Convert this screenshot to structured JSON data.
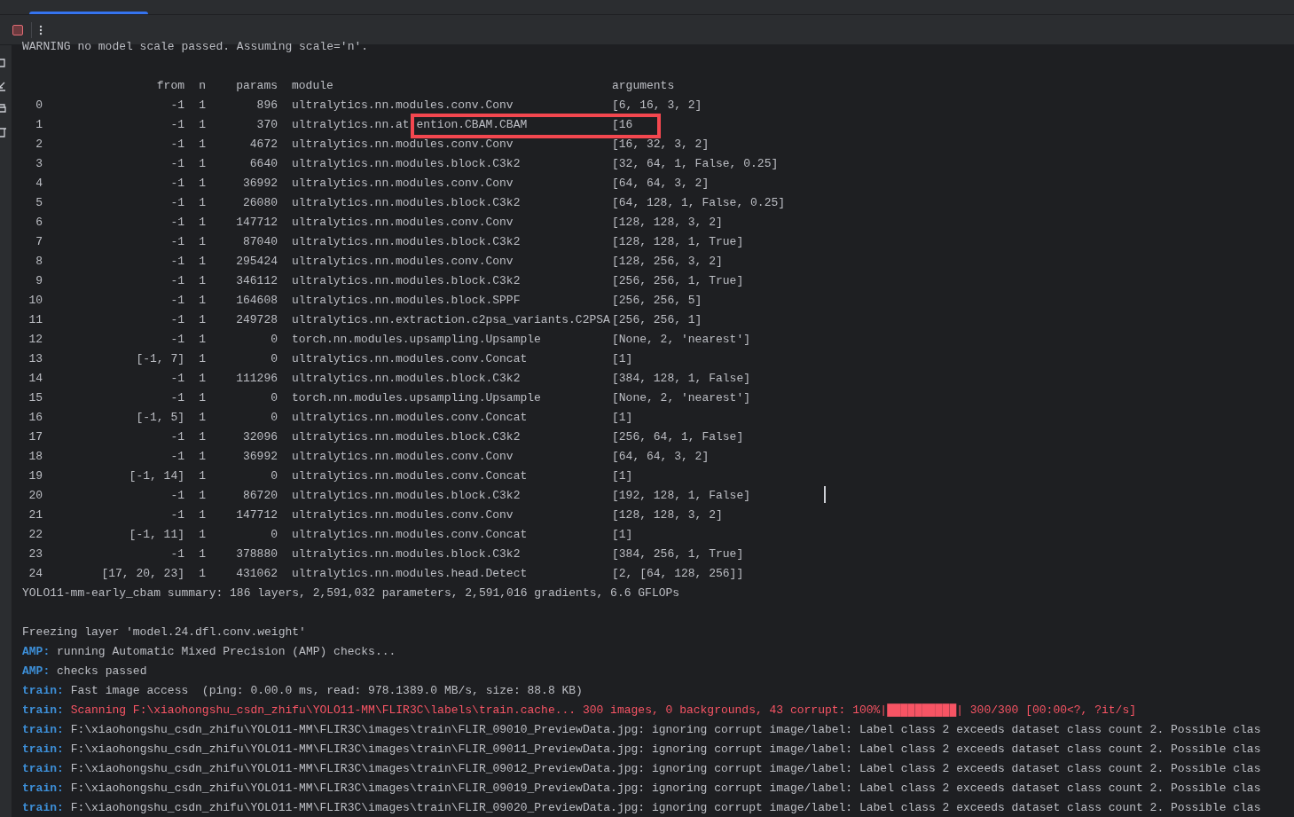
{
  "console": {
    "warning": "WARNING no model scale passed. Assuming scale='n'.",
    "header": {
      "from": "from",
      "n": "n",
      "params": "params",
      "module": "module",
      "arguments": "arguments"
    },
    "layers": [
      {
        "index": "0",
        "from": "-1",
        "n": "1",
        "params": "896",
        "module": "ultralytics.nn.modules.conv.Conv",
        "arguments": "[6, 16, 3, 2]"
      },
      {
        "index": "1",
        "from": "-1",
        "n": "1",
        "params": "370",
        "module": "ultralytics.nn.at",
        "module_continued": "ention.CBAM.CBAM",
        "arguments": "[16"
      },
      {
        "index": "2",
        "from": "-1",
        "n": "1",
        "params": "4672",
        "module": "ultralytics.nn.modules.conv.Conv",
        "arguments": "[16, 32, 3, 2]"
      },
      {
        "index": "3",
        "from": "-1",
        "n": "1",
        "params": "6640",
        "module": "ultralytics.nn.modules.block.C3k2",
        "arguments": "[32, 64, 1, False, 0.25]"
      },
      {
        "index": "4",
        "from": "-1",
        "n": "1",
        "params": "36992",
        "module": "ultralytics.nn.modules.conv.Conv",
        "arguments": "[64, 64, 3, 2]"
      },
      {
        "index": "5",
        "from": "-1",
        "n": "1",
        "params": "26080",
        "module": "ultralytics.nn.modules.block.C3k2",
        "arguments": "[64, 128, 1, False, 0.25]"
      },
      {
        "index": "6",
        "from": "-1",
        "n": "1",
        "params": "147712",
        "module": "ultralytics.nn.modules.conv.Conv",
        "arguments": "[128, 128, 3, 2]"
      },
      {
        "index": "7",
        "from": "-1",
        "n": "1",
        "params": "87040",
        "module": "ultralytics.nn.modules.block.C3k2",
        "arguments": "[128, 128, 1, True]"
      },
      {
        "index": "8",
        "from": "-1",
        "n": "1",
        "params": "295424",
        "module": "ultralytics.nn.modules.conv.Conv",
        "arguments": "[128, 256, 3, 2]"
      },
      {
        "index": "9",
        "from": "-1",
        "n": "1",
        "params": "346112",
        "module": "ultralytics.nn.modules.block.C3k2",
        "arguments": "[256, 256, 1, True]"
      },
      {
        "index": "10",
        "from": "-1",
        "n": "1",
        "params": "164608",
        "module": "ultralytics.nn.modules.block.SPPF",
        "arguments": "[256, 256, 5]"
      },
      {
        "index": "11",
        "from": "-1",
        "n": "1",
        "params": "249728",
        "module": "ultralytics.nn.extraction.c2psa_variants.C2PSA",
        "arguments": "[256, 256, 1]"
      },
      {
        "index": "12",
        "from": "-1",
        "n": "1",
        "params": "0",
        "module": "torch.nn.modules.upsampling.Upsample",
        "arguments": "[None, 2, 'nearest']"
      },
      {
        "index": "13",
        "from": "[-1, 7]",
        "n": "1",
        "params": "0",
        "module": "ultralytics.nn.modules.conv.Concat",
        "arguments": "[1]"
      },
      {
        "index": "14",
        "from": "-1",
        "n": "1",
        "params": "111296",
        "module": "ultralytics.nn.modules.block.C3k2",
        "arguments": "[384, 128, 1, False]"
      },
      {
        "index": "15",
        "from": "-1",
        "n": "1",
        "params": "0",
        "module": "torch.nn.modules.upsampling.Upsample",
        "arguments": "[None, 2, 'nearest']"
      },
      {
        "index": "16",
        "from": "[-1, 5]",
        "n": "1",
        "params": "0",
        "module": "ultralytics.nn.modules.conv.Concat",
        "arguments": "[1]"
      },
      {
        "index": "17",
        "from": "-1",
        "n": "1",
        "params": "32096",
        "module": "ultralytics.nn.modules.block.C3k2",
        "arguments": "[256, 64, 1, False]"
      },
      {
        "index": "18",
        "from": "-1",
        "n": "1",
        "params": "36992",
        "module": "ultralytics.nn.modules.conv.Conv",
        "arguments": "[64, 64, 3, 2]"
      },
      {
        "index": "19",
        "from": "[-1, 14]",
        "n": "1",
        "params": "0",
        "module": "ultralytics.nn.modules.conv.Concat",
        "arguments": "[1]"
      },
      {
        "index": "20",
        "from": "-1",
        "n": "1",
        "params": "86720",
        "module": "ultralytics.nn.modules.block.C3k2",
        "arguments": "[192, 128, 1, False]"
      },
      {
        "index": "21",
        "from": "-1",
        "n": "1",
        "params": "147712",
        "module": "ultralytics.nn.modules.conv.Conv",
        "arguments": "[128, 128, 3, 2]"
      },
      {
        "index": "22",
        "from": "[-1, 11]",
        "n": "1",
        "params": "0",
        "module": "ultralytics.nn.modules.conv.Concat",
        "arguments": "[1]"
      },
      {
        "index": "23",
        "from": "-1",
        "n": "1",
        "params": "378880",
        "module": "ultralytics.nn.modules.block.C3k2",
        "arguments": "[384, 256, 1, True]"
      },
      {
        "index": "24",
        "from": "[17, 20, 23]",
        "n": "1",
        "params": "431062",
        "module": "ultralytics.nn.modules.head.Detect",
        "arguments": "[2, [64, 128, 256]]"
      }
    ],
    "lines": [
      {
        "kind": "plain",
        "text": "YOLO11-mm-early_cbam summary: 186 layers, 2,591,032 parameters, 2,591,016 gradients, 6.6 GFLOPs"
      },
      {
        "kind": "blank"
      },
      {
        "kind": "plain",
        "text": "Freezing layer 'model.24.dfl.conv.weight'"
      },
      {
        "kind": "tagged",
        "tag": "AMP:",
        "text": "running Automatic Mixed Precision (AMP) checks...",
        "error": false
      },
      {
        "kind": "tagged",
        "tag": "AMP:",
        "text": "checks passed",
        "error": false
      },
      {
        "kind": "tagged",
        "tag": "train:",
        "text": "Fast image access  (ping: 0.00.0 ms, read: 978.1389.0 MB/s, size: 88.8 KB)",
        "error": false
      },
      {
        "kind": "tagged",
        "tag": "train:",
        "text": "Scanning F:\\xiaohongshu_csdn_zhifu\\YOLO11-MM\\FLIR3C\\labels\\train.cache... 300 images, 0 backgrounds, 43 corrupt: 100%|██████████| 300/300 [00:00<?, ?it/s]",
        "error": true
      },
      {
        "kind": "tagged",
        "tag": "train:",
        "text": "F:\\xiaohongshu_csdn_zhifu\\YOLO11-MM\\FLIR3C\\images\\train\\FLIR_09010_PreviewData.jpg: ignoring corrupt image/label: Label class 2 exceeds dataset class count 2. Possible clas",
        "error": false
      },
      {
        "kind": "tagged",
        "tag": "train:",
        "text": "F:\\xiaohongshu_csdn_zhifu\\YOLO11-MM\\FLIR3C\\images\\train\\FLIR_09011_PreviewData.jpg: ignoring corrupt image/label: Label class 2 exceeds dataset class count 2. Possible clas",
        "error": false
      },
      {
        "kind": "tagged",
        "tag": "train:",
        "text": "F:\\xiaohongshu_csdn_zhifu\\YOLO11-MM\\FLIR3C\\images\\train\\FLIR_09012_PreviewData.jpg: ignoring corrupt image/label: Label class 2 exceeds dataset class count 2. Possible clas",
        "error": false
      },
      {
        "kind": "tagged",
        "tag": "train:",
        "text": "F:\\xiaohongshu_csdn_zhifu\\YOLO11-MM\\FLIR3C\\images\\train\\FLIR_09019_PreviewData.jpg: ignoring corrupt image/label: Label class 2 exceeds dataset class count 2. Possible clas",
        "error": false
      },
      {
        "kind": "tagged",
        "tag": "train:",
        "text": "F:\\xiaohongshu_csdn_zhifu\\YOLO11-MM\\FLIR3C\\images\\train\\FLIR_09020_PreviewData.jpg: ignoring corrupt image/label: Label class 2 exceeds dataset class count 2. Possible clas",
        "error": false
      }
    ]
  }
}
